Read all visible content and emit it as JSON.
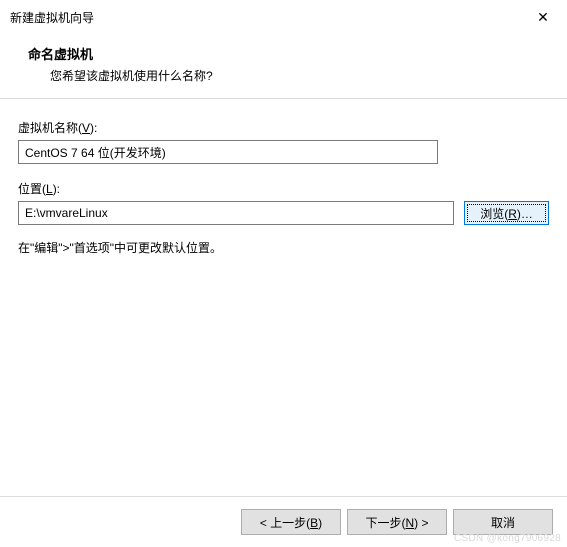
{
  "window": {
    "title": "新建虚拟机向导",
    "close_glyph": "✕"
  },
  "header": {
    "title": "命名虚拟机",
    "subtitle": "您希望该虚拟机使用什么名称?"
  },
  "form": {
    "name": {
      "label_prefix": "虚拟机名称(",
      "label_accel": "V",
      "label_suffix": "):",
      "value": "CentOS 7 64 位(开发环境)"
    },
    "location": {
      "label_prefix": "位置(",
      "label_accel": "L",
      "label_suffix": "):",
      "value": "E:\\vmvareLinux"
    },
    "browse": {
      "label_prefix": "浏览(",
      "label_accel": "R",
      "label_suffix": ")…"
    },
    "hint": "在\"编辑\">\"首选项\"中可更改默认位置。"
  },
  "footer": {
    "back": {
      "prefix": "< 上一步(",
      "accel": "B",
      "suffix": ")"
    },
    "next": {
      "prefix": "下一步(",
      "accel": "N",
      "suffix": ") >"
    },
    "cancel": {
      "label": "取消"
    }
  },
  "watermark": "CSDN @kong7906928"
}
